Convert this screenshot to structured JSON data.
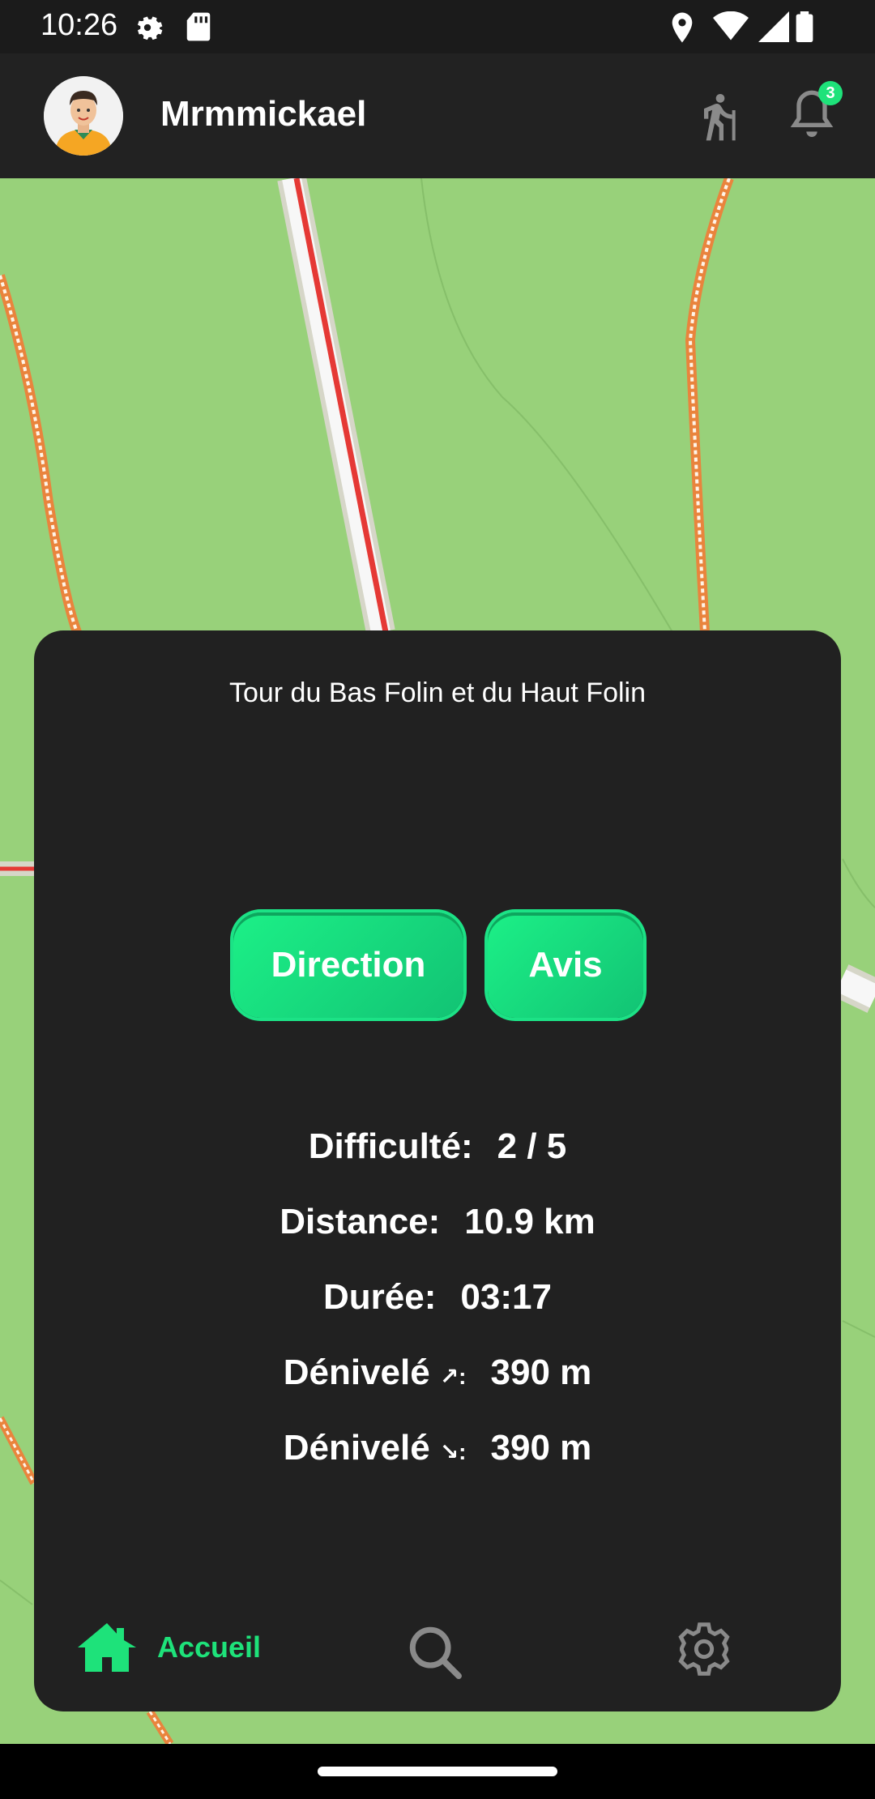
{
  "status_bar": {
    "time": "10:26",
    "icons_left": [
      "gear-icon",
      "sd-card-icon"
    ],
    "icons_right": [
      "location-icon",
      "wifi-icon",
      "signal-icon",
      "battery-icon"
    ]
  },
  "header": {
    "username": "Mrmmickael",
    "notification_count": "3",
    "icons": [
      "avatar",
      "hiker-icon",
      "bell-icon"
    ]
  },
  "card": {
    "title": "Tour du Bas Folin et du Haut Folin",
    "buttons": {
      "direction": "Direction",
      "avis": "Avis"
    },
    "stats": [
      {
        "label": "Difficulté:",
        "arrow": "",
        "value": "2 / 5"
      },
      {
        "label": "Distance:",
        "arrow": "",
        "value": "10.9 km"
      },
      {
        "label": "Durée:",
        "arrow": "",
        "value": "03:17"
      },
      {
        "label": "Dénivelé",
        "arrow": "↗:",
        "value": "390 m"
      },
      {
        "label": "Dénivelé",
        "arrow": "↘:",
        "value": "390 m"
      }
    ]
  },
  "bottom_nav": {
    "home_label": "Accueil",
    "active": "home",
    "active_color": "#1ee27a",
    "icons": [
      "home-icon",
      "search-icon",
      "settings-icon"
    ]
  },
  "colors": {
    "map_bg": "#98d17a",
    "card_bg": "#212121",
    "accent": "#1ee27a"
  }
}
